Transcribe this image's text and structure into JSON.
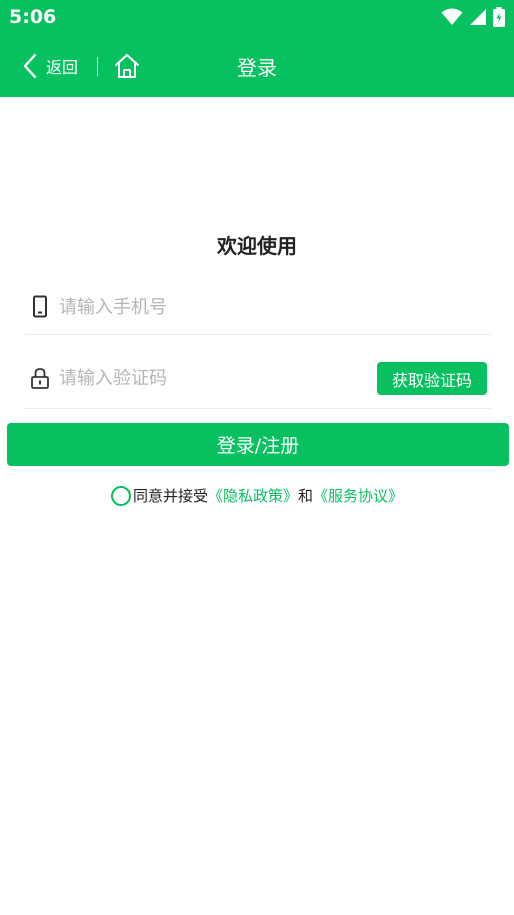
{
  "status_bar": {
    "time": "5:06"
  },
  "nav": {
    "back_label": "返回",
    "title": "登录"
  },
  "welcome": "欢迎使用",
  "phone_field": {
    "placeholder": "请输入手机号"
  },
  "code_field": {
    "placeholder": "请输入验证码",
    "get_code_label": "获取验证码"
  },
  "submit_label": "登录/注册",
  "agreement": {
    "prefix": "同意并接受",
    "privacy_link": "《隐私政策》",
    "and": "和",
    "service_link": "《服务协议》"
  },
  "colors": {
    "accent": "#07c160",
    "text": "#222222",
    "placeholder": "#b5b5b5"
  }
}
